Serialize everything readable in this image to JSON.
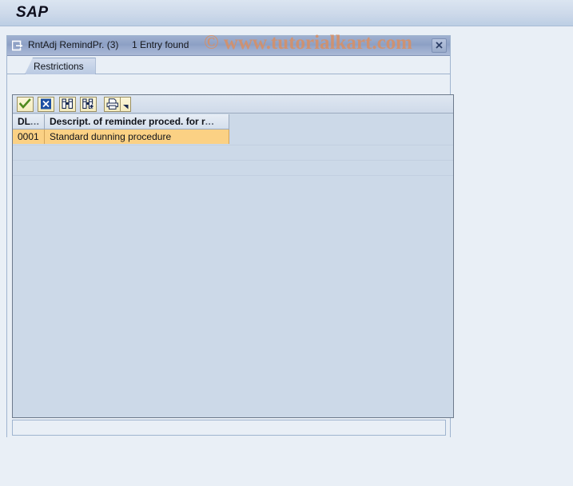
{
  "app": {
    "logo_text": "SAP",
    "background_color": "#e9eff6",
    "header_gradient_top": "#dbe5f1",
    "header_gradient_bottom": "#bccee4"
  },
  "watermark": {
    "text": "© www.tutorialkart.com",
    "color": "#d98f63"
  },
  "dialog": {
    "title": "RntAdj RemindPr. (3)",
    "entry_count": "1 Entry found",
    "title_icon": "open-selection-icon",
    "close_icon": "close-icon",
    "close_label": "Close"
  },
  "tabs": [
    {
      "label": "Restrictions",
      "selected": true
    }
  ],
  "toolbar": {
    "buttons": [
      {
        "name": "continue-button",
        "icon": "check-icon",
        "tooltip": "Copy"
      },
      {
        "name": "cancel-button",
        "icon": "cancel-x-icon",
        "tooltip": "Cancel"
      },
      {
        "name": "find-button",
        "icon": "binoculars-icon",
        "tooltip": "Find"
      },
      {
        "name": "find-next-button",
        "icon": "binoculars-plus-icon",
        "tooltip": "Find next"
      },
      {
        "name": "print-button",
        "icon": "printer-icon",
        "tooltip": "Print"
      },
      {
        "name": "print-menu-button",
        "icon": "triangle-down-icon",
        "tooltip": "More print options"
      }
    ]
  },
  "grid": {
    "columns": [
      {
        "key": "dl",
        "label": "DL",
        "truncated_suffix": "..."
      },
      {
        "key": "desc",
        "label": "Descript. of reminder proced. for r",
        "truncated_suffix": "..."
      }
    ],
    "rows": [
      {
        "dl": "0001",
        "desc": "Standard dunning procedure",
        "selected": true
      }
    ],
    "selection_color": "#fbd184"
  }
}
